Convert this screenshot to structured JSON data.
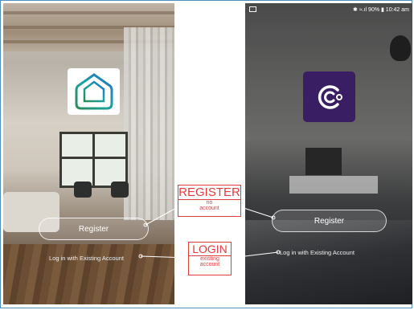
{
  "left_screen": {
    "app_icon": "home-app-icon",
    "register_label": "Register",
    "login_label": "Log in with Existing Account"
  },
  "right_screen": {
    "status_bar": "✱ ≈.ıl 90% ▮ 10:42 am",
    "app_icon": "smart-plug-app-icon",
    "register_label": "Register",
    "login_label": "Log in with Existing Account"
  },
  "callouts": {
    "register": {
      "title": "REGISTER",
      "subtitle_line1": "no",
      "subtitle_line2": "account"
    },
    "login": {
      "title": "LOGIN",
      "subtitle_line1": "existing",
      "subtitle_line2": "account"
    }
  },
  "colors": {
    "callout_red": "#e23b3b",
    "frame_blue": "#4f8fbf",
    "right_icon_purple": "#3a1e63",
    "left_icon_gradient_start": "#2e8b57",
    "left_icon_gradient_end": "#1f6fd0"
  }
}
